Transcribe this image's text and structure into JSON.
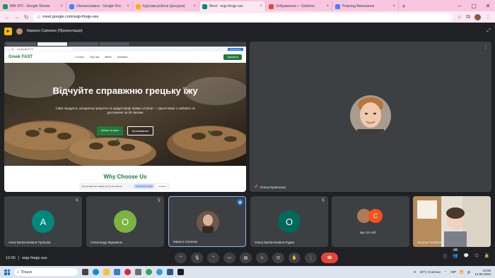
{
  "browser": {
    "tabs": [
      {
        "title": "ІКМ-1P2 - Google Sheets",
        "color": "#0f9d58",
        "active": false
      },
      {
        "title": "сбалансовано - Google Doc",
        "color": "#4285f4",
        "active": false
      },
      {
        "title": "Курсова роботи (ресурси)",
        "color": "#f4b400",
        "active": false
      },
      {
        "title": "Meet - wqp-fmqjs-oss",
        "color": "#00897b",
        "active": true
      },
      {
        "title": "Зображення — Шаблон",
        "color": "#ea4335",
        "active": false
      },
      {
        "title": "Розклад Виконання",
        "color": "#4285f4",
        "active": false
      }
    ],
    "new_tab": "+",
    "url": "meet.google.com/wqp-fmqjs-oss"
  },
  "meet": {
    "presenter_label": "Кирило Сапенко (Презентація)",
    "presentation": {
      "inner_url": "localhost:5173",
      "share_badge": "Поділитися",
      "site_logo": "Greek FAST",
      "nav_links": [
        "Головна",
        "Про нас",
        "Меню",
        "Контакти"
      ],
      "order_button": "Замовити",
      "hero_title": "Відчуйте справжню грецьку їжу",
      "hero_subtitle": "Свіжі продукти, натуральні рецепти та щедрі порції прямо з Греції — приготовані з любов'ю та доставлені за 30 хвилин",
      "primary_cta": "Меню та ціни",
      "secondary_cta": "Бронювання",
      "section_heading": "Why Choose Us",
      "share_bar_text": "meet.google.com надає доступ до екрана",
      "stop_sharing": "Припинити показ",
      "hide": "Сховати"
    },
    "speaker": {
      "name": "Олена Кравченко"
    },
    "participants": [
      {
        "name": "Анна Валентинівна Пузікова",
        "initial": "A",
        "color": "#00897b"
      },
      {
        "name": "Олександр Журавель",
        "initial": "O",
        "color": "#7cb342"
      },
      {
        "name": "Кирило Сапенко",
        "initial": "",
        "color": "#6d4c41"
      },
      {
        "name": "Ольга Валентинівна Рудик",
        "initial": "O",
        "color": "#00695c"
      },
      {
        "name": "Ще 10 осіб",
        "initial": "C",
        "color": "#f4511e"
      },
      {
        "name": "Оксана Петрівна",
        "initial": "",
        "color": "#8d6e63"
      }
    ],
    "clock": "12:05",
    "meeting_code": "wqp-fmqjs-oss",
    "participant_count": "15"
  },
  "taskbar": {
    "search_placeholder": "Пошук",
    "weather": "20°C Сонячно",
    "lang": "УКР",
    "time": "12:05",
    "date": "14.05.2024"
  }
}
